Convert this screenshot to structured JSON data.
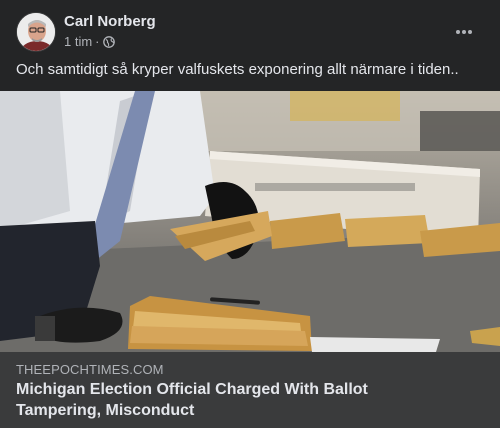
{
  "post": {
    "author": "Carl Norberg",
    "time": "1 tim",
    "separator": "·",
    "privacy_icon": "globe-icon",
    "more_icon": "more-horizontal-icon",
    "text": "Och samtidigt så kryper valfuskets exponering allt närmare i tiden.."
  },
  "link_preview": {
    "domain": "THEEPOCHTIMES.COM",
    "headline": "Michigan Election Official Charged With Ballot Tampering, Misconduct"
  },
  "colors": {
    "background": "#242526",
    "preview_bar": "#3a3b3c",
    "text_primary": "#e4e6eb",
    "text_secondary": "#b0b3b8"
  }
}
